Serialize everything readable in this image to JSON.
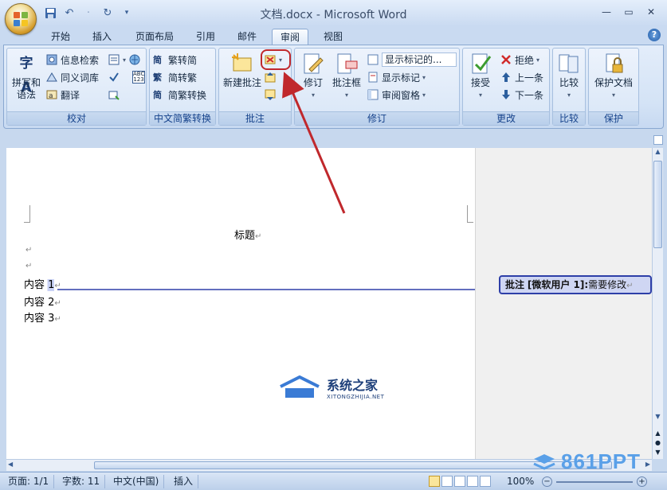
{
  "window": {
    "title": "文档.docx - Microsoft Word"
  },
  "tabs": [
    "开始",
    "插入",
    "页面布局",
    "引用",
    "邮件",
    "审阅",
    "视图"
  ],
  "active_tab": "审阅",
  "ribbon": {
    "proofing": {
      "label": "校对",
      "spelling": "拼写和\n语法",
      "research": "信息检索",
      "thesaurus": "同义词库",
      "translate": "翻译",
      "spelling_glyph": "字A",
      "wordcount_glyph": "ABC\n123"
    },
    "chinese": {
      "label": "中文简繁转换",
      "to_trad": "繁转简",
      "to_simp": "简转繁",
      "convert": "简繁转换",
      "to_trad_glyph": "简",
      "to_simp_glyph": "繁",
      "convert_glyph": "简"
    },
    "comments": {
      "label": "批注",
      "new_comment": "新建批注"
    },
    "tracking": {
      "label": "修订",
      "track_changes": "修订",
      "balloons": "批注框",
      "display": "显示标记的...",
      "show_markup": "显示标记",
      "reviewing_pane": "审阅窗格"
    },
    "changes": {
      "label": "更改",
      "accept": "接受",
      "reject": "拒绝",
      "previous": "上一条",
      "next": "下一条"
    },
    "compare": {
      "label": "比较",
      "compare": "比较"
    },
    "protect": {
      "label": "保护",
      "protect_doc": "保护文档"
    }
  },
  "document": {
    "title_line": "标题",
    "lines": [
      "内容 1",
      "内容 2",
      "内容 3"
    ],
    "para_mark": "↵",
    "comment_marker": "1"
  },
  "comment": {
    "label": "批注",
    "author": "[微软用户 1]:",
    "text": "需要修改"
  },
  "watermark": {
    "name": "系统之家",
    "url": "XITONGZHIJIA.NET",
    "brand2": "861PPT"
  },
  "status": {
    "page": "页面: 1/1",
    "words": "字数: 11",
    "language": "中文(中国)",
    "mode": "插入",
    "zoom": "100%"
  },
  "colors": {
    "accent": "#2e3fa8",
    "arrow": "#c0282c"
  }
}
